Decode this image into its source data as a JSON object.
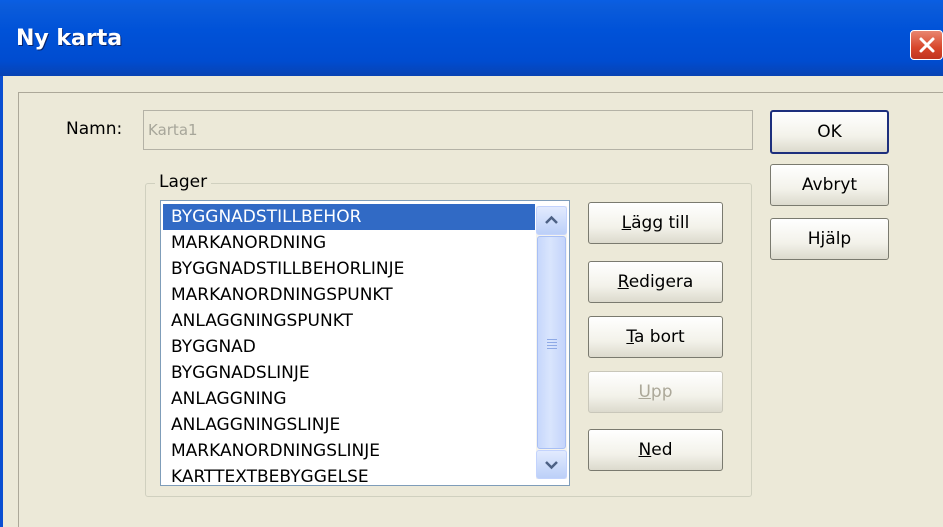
{
  "window": {
    "title": "Ny karta",
    "close_icon": "close-icon"
  },
  "form": {
    "name_label": "Namn:",
    "name_value": "Karta1",
    "group_label": "Lager"
  },
  "layers": [
    {
      "label": "BYGGNADSTILLBEHOR",
      "selected": true
    },
    {
      "label": "MARKANORDNING"
    },
    {
      "label": "BYGGNADSTILLBEHORLINJE"
    },
    {
      "label": "MARKANORDNINGSPUNKT"
    },
    {
      "label": "ANLAGGNINGSPUNKT"
    },
    {
      "label": "BYGGNAD"
    },
    {
      "label": "BYGGNADSLINJE"
    },
    {
      "label": "ANLAGGNING"
    },
    {
      "label": "ANLAGGNINGSLINJE"
    },
    {
      "label": "MARKANORDNINGSLINJE"
    },
    {
      "label": "KARTTEXTBEBYGGELSE"
    }
  ],
  "layer_buttons": {
    "add": {
      "first": "L",
      "rest": "ägg till"
    },
    "edit": {
      "first": "R",
      "rest": "edigera"
    },
    "remove": {
      "first": "T",
      "rest": "a bort"
    },
    "up": {
      "first": "U",
      "rest": "pp"
    },
    "down": {
      "first": "N",
      "rest": "ed"
    }
  },
  "dialog_buttons": {
    "ok": "OK",
    "cancel": "Avbryt",
    "help": "Hjälp"
  },
  "colors": {
    "title_bar": "#0052d8",
    "selection": "#316ac5",
    "close": "#d8462a"
  }
}
